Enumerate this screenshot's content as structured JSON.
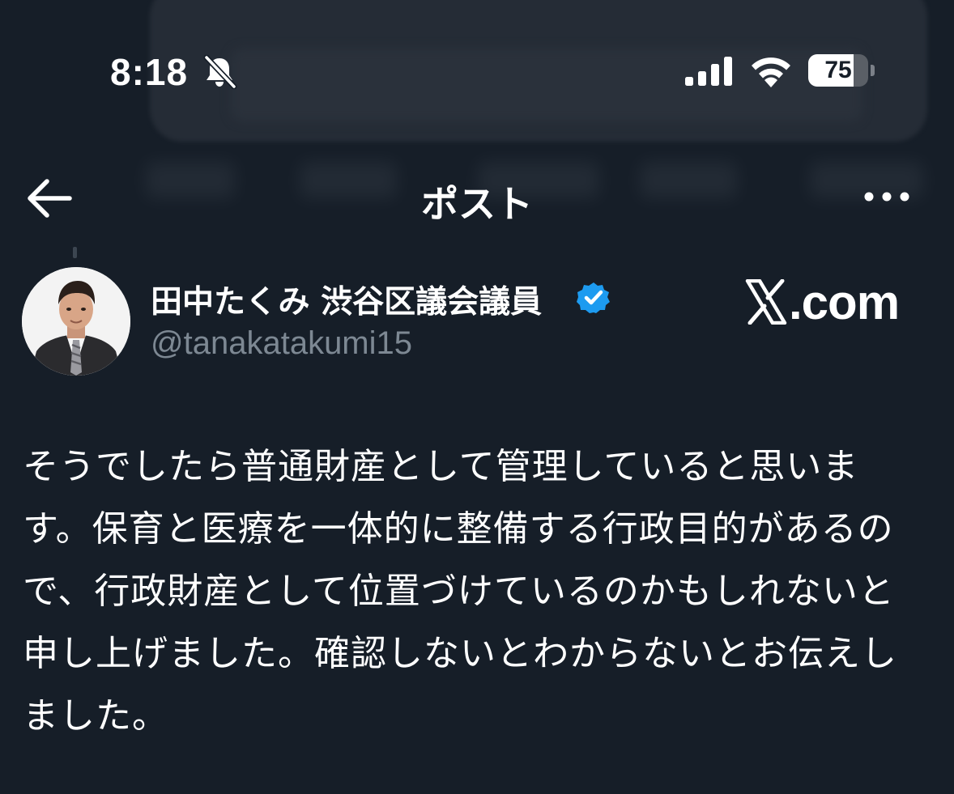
{
  "status_bar": {
    "time": "8:18",
    "battery_level": "75",
    "battery_fraction": 0.75,
    "icons": [
      "bell-slash-icon",
      "cellular-signal-icon",
      "wifi-icon",
      "battery-icon"
    ]
  },
  "nav": {
    "title": "ポスト",
    "back_icon": "arrow-left-icon",
    "more_icon": "ellipsis-icon"
  },
  "post": {
    "author_name": "田中たくみ 渋谷区議会議員",
    "author_handle": "@tanakatakumi15",
    "verified": true,
    "verified_color": "#1d9bf0",
    "text": "そうでしたら普通財産として管理していると思います。保育と医療を一体的に整備する行政目的があるので、行政財産として位置づけているのかもしれないと申し上げました。確認しないとわからないとお伝えしました。"
  },
  "watermark": {
    "suffix": ".com"
  },
  "colors": {
    "background": "#161e28",
    "text_primary": "#ffffff",
    "text_secondary": "#7d8893"
  }
}
